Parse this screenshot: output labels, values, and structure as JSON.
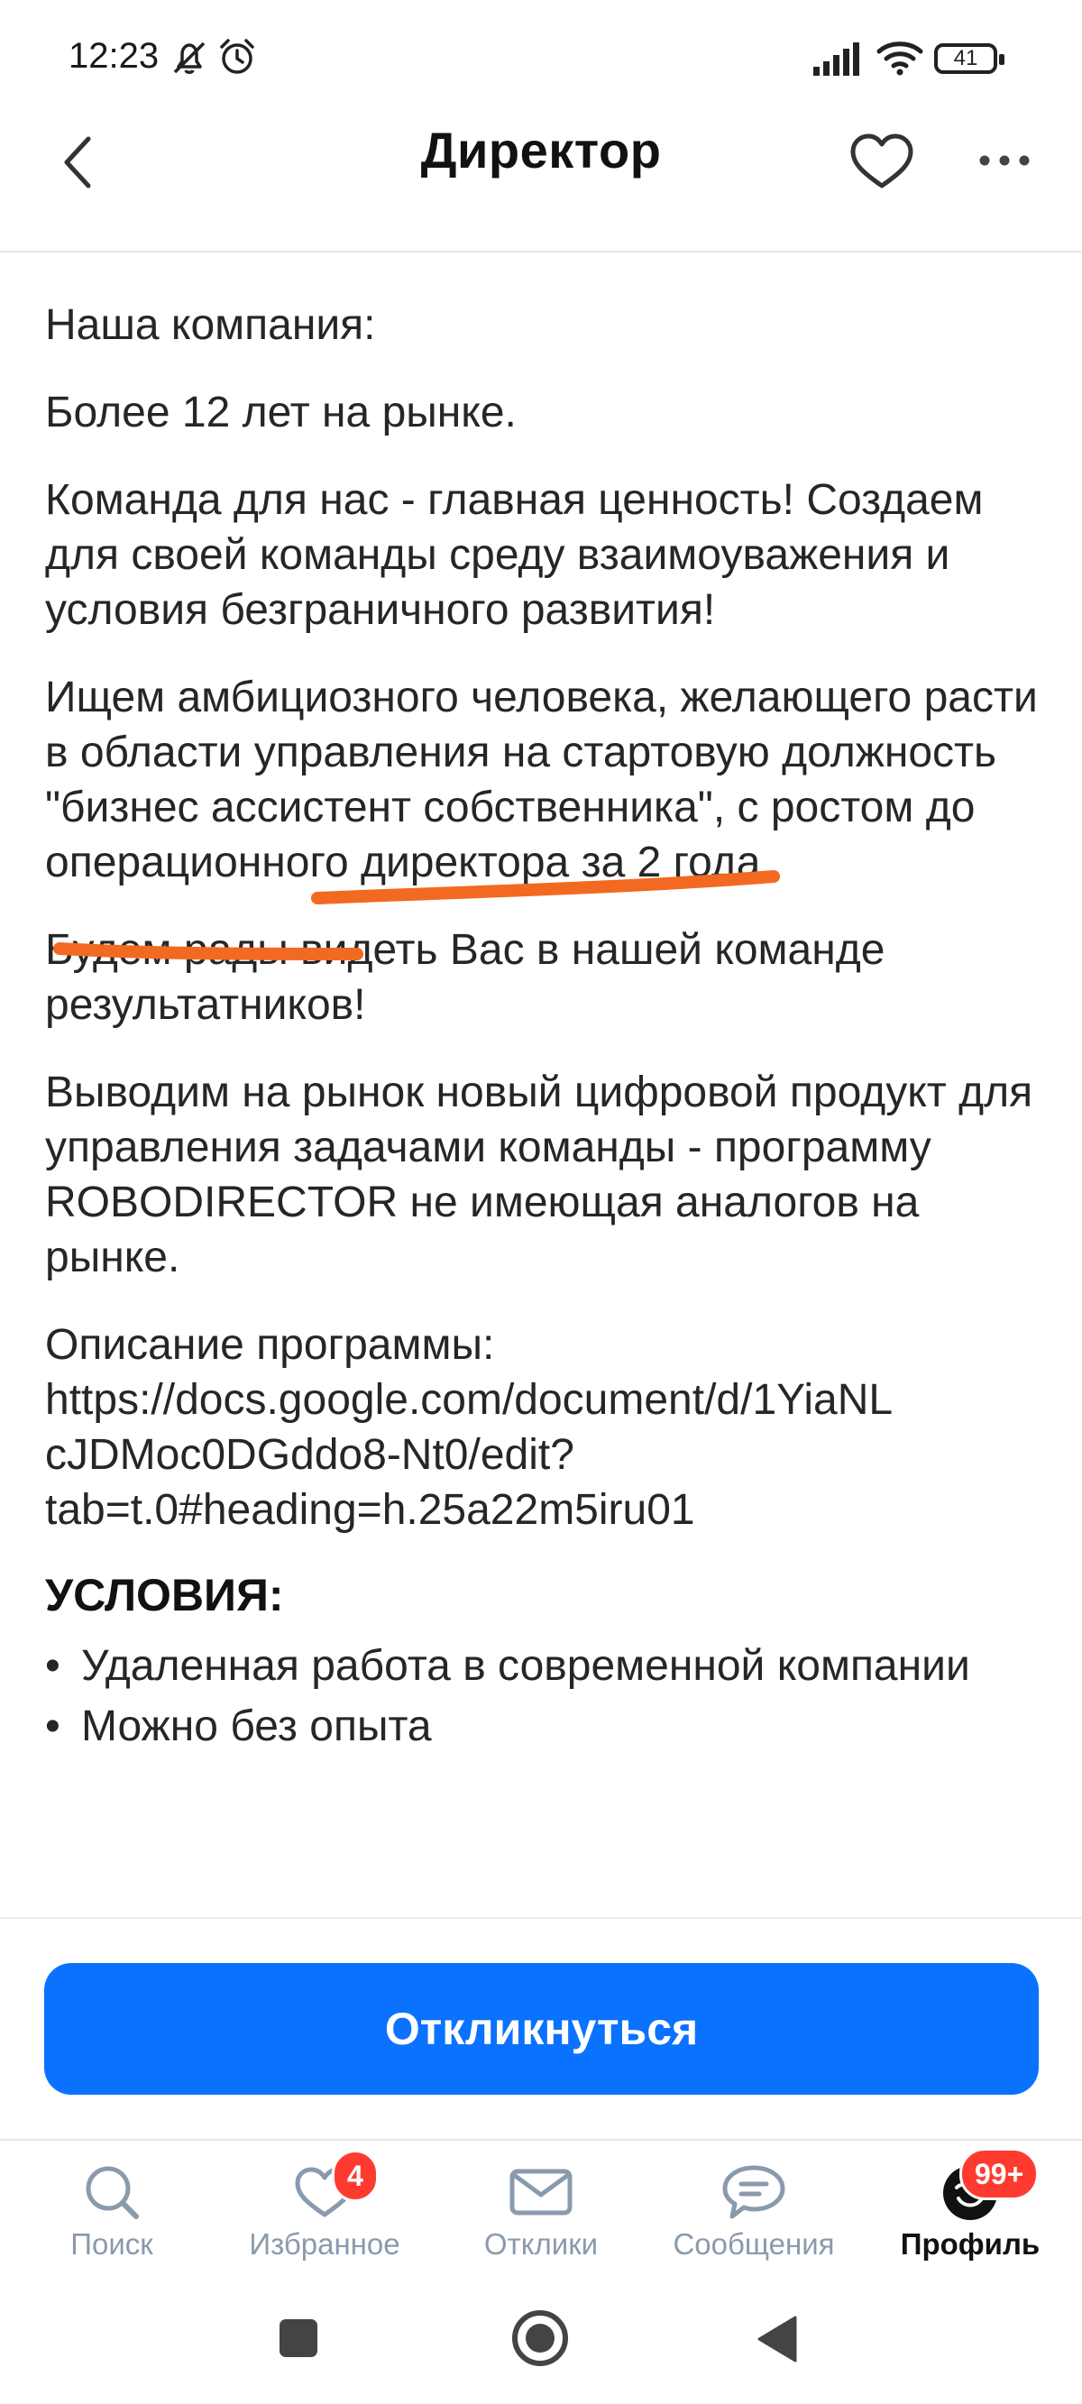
{
  "status_bar": {
    "time": "12:23",
    "battery": "41",
    "icons": [
      "bell-off-icon",
      "alarm-icon",
      "signal-icon",
      "wifi-icon",
      "battery-icon"
    ]
  },
  "header": {
    "title": "Директор",
    "back_icon": "chevron-left-icon",
    "favorite_icon": "heart-outline-icon",
    "more_icon": "more-dots-icon"
  },
  "description": {
    "paragraphs": [
      "Наша компания:",
      "Более 12 лет на рынке.",
      "Команда для нас - главная ценность! Создаем для своей команды среду взаимоуважения и условия безграничного развития!",
      "Ищем амбициозного человека, желающего расти в области управления на стартовую должность \"бизнес ассистент собственника\", с ростом до операционного директора за 2 года.",
      "Будем рады видеть Вас в нашей команде результатников!",
      "Выводим на рынок новый цифровой продукт для управления задачами команды - программу ROBODIRECTOR не имеющая аналогов на рынке."
    ],
    "program_label": "Описание программы:",
    "program_url": "https://docs.google.com/document/d/1YiaNL\ncJDMoc0DGddo8-Nt0/edit?\ntab=t.0#heading=h.25a22m5iru01",
    "conditions_title": "УСЛОВИЯ:",
    "conditions": [
      "Удаленная работа в современной компании",
      "Можно без опыта"
    ],
    "highlight_color": "#f26a21"
  },
  "actions": {
    "respond_label": "Откликнуться",
    "primary_color": "#0a72ff"
  },
  "bottom_nav": {
    "items": [
      {
        "label": "Поиск",
        "icon": "search-icon"
      },
      {
        "label": "Избранное",
        "icon": "heart-icon",
        "badge": "4"
      },
      {
        "label": "Отклики",
        "icon": "envelope-icon"
      },
      {
        "label": "Сообщения",
        "icon": "chat-bubble-icon"
      },
      {
        "label": "Профиль",
        "icon": "profile-avatar-icon",
        "badge": "99+",
        "active": true
      }
    ]
  },
  "system_nav": {
    "icons": [
      "recent-apps-icon",
      "home-icon",
      "back-icon"
    ]
  }
}
